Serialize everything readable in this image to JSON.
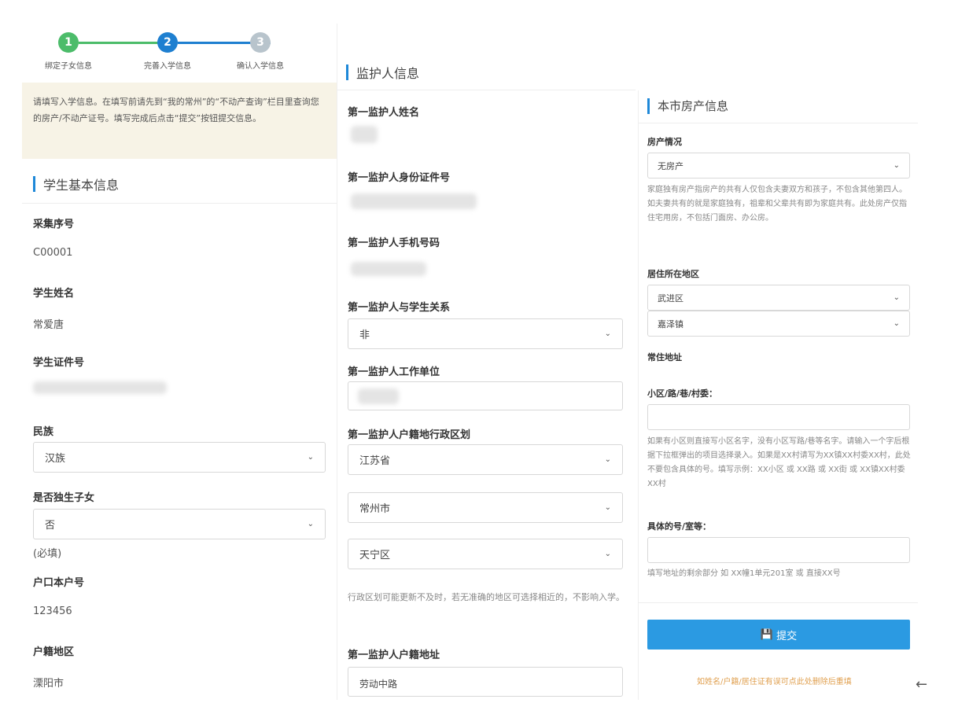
{
  "stepper": {
    "steps": [
      {
        "num": "1",
        "label": "绑定子女信息",
        "color": "#4cbc6a"
      },
      {
        "num": "2",
        "label": "完善入学信息",
        "color": "#1e7fd0"
      },
      {
        "num": "3",
        "label": "确认入学信息",
        "color": "#b8c4cc"
      }
    ]
  },
  "notice": "请填写入学信息。在填写前请先到“我的常州”的“不动产查询”栏目里查询您的房产/不动产证号。填写完成后点击“提交”按钮提交信息。",
  "student": {
    "section_title": "学生基本信息",
    "serial_label": "采集序号",
    "serial_value": "C00001",
    "name_label": "学生姓名",
    "name_value": "常爱唐",
    "id_label": "学生证件号",
    "ethnic_label": "民族",
    "ethnic_value": "汉族",
    "only_child_label": "是否独生子女",
    "only_child_value": "否",
    "required_note": "(必填)",
    "hukou_no_label": "户口本户号",
    "hukou_no_value": "123456",
    "hukou_region_label": "户籍地区",
    "hukou_region_value": "溧阳市"
  },
  "guardian": {
    "section_title": "监护人信息",
    "name_label": "第一监护人姓名",
    "id_label": "第一监护人身份证件号",
    "phone_label": "第一监护人手机号码",
    "relation_label": "第一监护人与学生关系",
    "relation_value": "非",
    "work_label": "第一监护人工作单位",
    "division_label": "第一监护人户籍地行政区划",
    "province_value": "江苏省",
    "city_value": "常州市",
    "district_value": "天宁区",
    "division_note": "行政区划可能更新不及时，若无准确的地区可选择相近的，不影响入学。",
    "address_label": "第一监护人户籍地址",
    "address_value": "劳动中路"
  },
  "property": {
    "section_title": "本市房产信息",
    "status_label": "房产情况",
    "status_value": "无房产",
    "status_note": "家庭独有房产指房产的共有人仅包含夫妻双方和孩子，不包含其他第四人。如夫妻共有的就是家庭独有，祖辈和父辈共有即为家庭共有。此处房产仅指住宅用房，不包括门面房、办公房。",
    "residence_label": "居住所在地区",
    "district_value": "武进区",
    "town_value": "嘉泽镇",
    "address_label": "常住地址",
    "community_label": "小区/路/巷/村委：",
    "community_note": "如果有小区则直接写小区名字，没有小区写路/巷等名字。请输入一个字后根据下拉框弹出的项目选择录入。如果是XX村请写为XX镇XX村委XX村，此处不要包含具体的号。填写示例：XX小区 或 XX路 或 XX街 或 XX镇XX村委XX村",
    "detail_label": "具体的号/室等：",
    "detail_note": "填写地址的剩余部分 如 XX幢1单元201室 或 直接XX号",
    "submit_label": "提交",
    "footer_link": "如姓名/户籍/居住证有误可点此处删除后重填",
    "back_icon": "←"
  },
  "colors": {
    "accent": "#1e88d8",
    "submit": "#2b9ae2",
    "notice_bg": "#f7f3e6",
    "footer_link": "#e0a050"
  }
}
